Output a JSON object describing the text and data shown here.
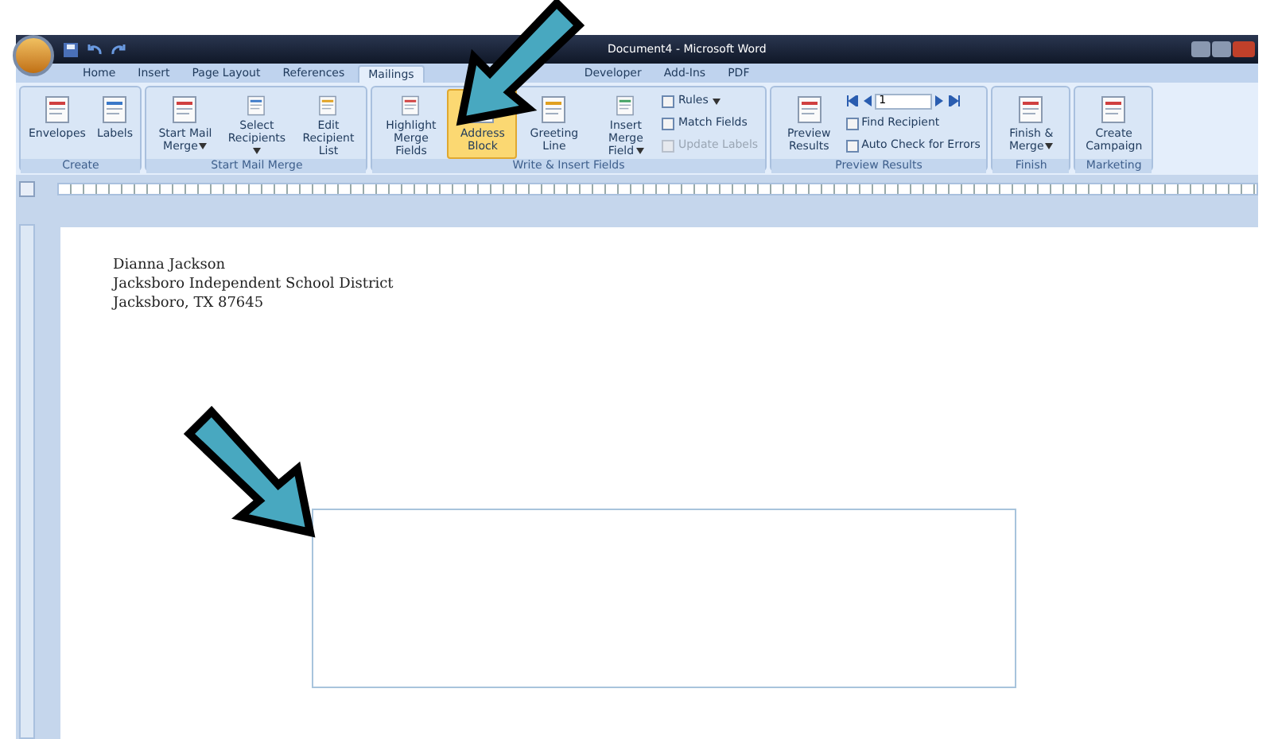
{
  "window": {
    "title": "Document4 - Microsoft Word"
  },
  "tabs": [
    {
      "label": "Home",
      "selected": false
    },
    {
      "label": "Insert",
      "selected": false
    },
    {
      "label": "Page Layout",
      "selected": false
    },
    {
      "label": "References",
      "selected": false
    },
    {
      "label": "Mailings",
      "selected": true
    },
    {
      "label": "Developer",
      "selected": false
    },
    {
      "label": "Add-Ins",
      "selected": false
    },
    {
      "label": "PDF",
      "selected": false
    }
  ],
  "ribbon": {
    "groups": [
      {
        "label": "Create",
        "items": [
          {
            "kind": "large",
            "label": "Envelopes",
            "selected": false
          },
          {
            "kind": "large",
            "label": "Labels",
            "selected": false
          }
        ]
      },
      {
        "label": "Start Mail Merge",
        "items": [
          {
            "kind": "large",
            "label": "Start Mail Merge",
            "dropdown": true,
            "selected": false
          },
          {
            "kind": "large",
            "label": "Select Recipients",
            "dropdown": true,
            "selected": false
          },
          {
            "kind": "large",
            "label": "Edit Recipient List",
            "selected": false
          }
        ]
      },
      {
        "label": "Write & Insert Fields",
        "items": [
          {
            "kind": "large",
            "label": "Highlight Merge Fields",
            "selected": false
          },
          {
            "kind": "large",
            "label": "Address Block",
            "selected": true
          },
          {
            "kind": "large",
            "label": "Greeting Line",
            "selected": false
          },
          {
            "kind": "large",
            "label": "Insert Merge Field",
            "dropdown": true,
            "selected": false
          },
          {
            "kind": "small",
            "label": "Rules",
            "dropdown": true,
            "disabled": false
          },
          {
            "kind": "small",
            "label": "Match Fields",
            "disabled": false
          },
          {
            "kind": "small",
            "label": "Update Labels",
            "disabled": true
          }
        ]
      },
      {
        "label": "Preview Results",
        "items": [
          {
            "kind": "large",
            "label": "Preview Results",
            "selected": false
          },
          {
            "kind": "nav",
            "value": "1"
          },
          {
            "kind": "small",
            "label": "Find Recipient",
            "disabled": false
          },
          {
            "kind": "small",
            "label": "Auto Check for Errors",
            "disabled": false
          }
        ]
      },
      {
        "label": "Finish",
        "items": [
          {
            "kind": "large",
            "label": "Finish & Merge",
            "dropdown": true,
            "selected": false
          }
        ]
      },
      {
        "label": "Marketing",
        "items": [
          {
            "kind": "large",
            "label": "Create Campaign",
            "selected": false
          }
        ]
      }
    ]
  },
  "document": {
    "address_lines": [
      "Dianna Jackson",
      "Jacksboro Independent School District",
      "Jacksboro, TX 87645"
    ]
  }
}
